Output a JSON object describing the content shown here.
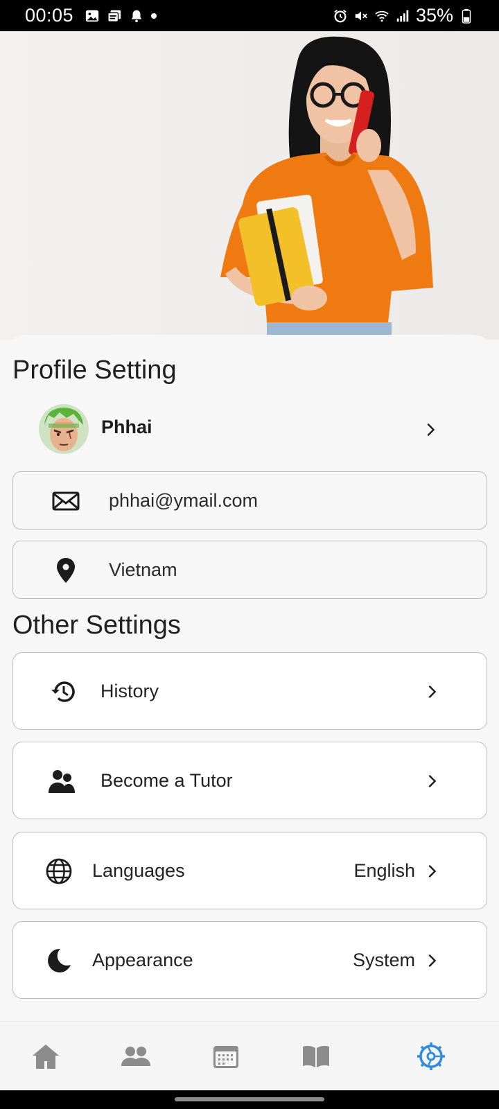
{
  "status_bar": {
    "time": "00:05",
    "battery": "35%",
    "left_icons": [
      "image-icon",
      "files-icon",
      "bell-icon",
      "dot-icon"
    ],
    "right_icons": [
      "alarm-icon",
      "mute-icon",
      "wifi-icon",
      "signal-icon",
      "battery-icon"
    ]
  },
  "profile_section": {
    "title": "Profile Setting",
    "name": "Phhai",
    "email": "phhai@ymail.com",
    "country": "Vietnam"
  },
  "other_section": {
    "title": "Other Settings",
    "items": [
      {
        "label": "History",
        "icon": "history-icon"
      },
      {
        "label": "Become a Tutor",
        "icon": "tutor-icon"
      },
      {
        "label": "Languages",
        "value": "English",
        "icon": "globe-icon"
      },
      {
        "label": "Appearance",
        "value": "System",
        "icon": "moon-icon"
      }
    ]
  },
  "bottom_nav": {
    "items": [
      "home-icon",
      "tutors-icon",
      "schedule-icon",
      "courses-icon",
      "settings-icon"
    ],
    "active": "settings-icon",
    "active_color": "#2e8be0",
    "inactive_color": "#8c8c8c"
  }
}
